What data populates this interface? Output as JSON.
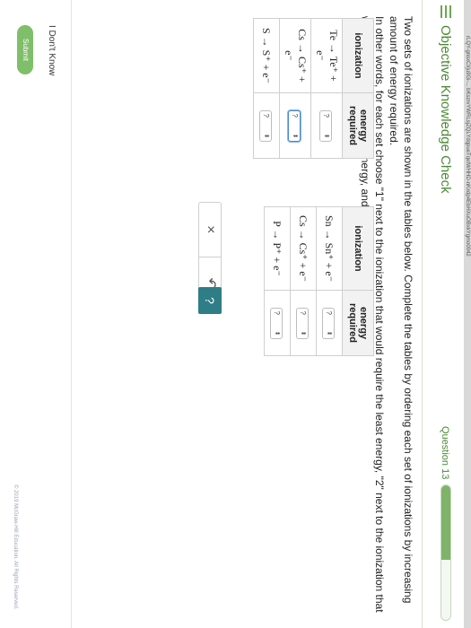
{
  "browser": {
    "url_fragment": "rLQY-gnsxCl/ju9Gi-... bKszrvYWRLsjZQLYdqpueTqetWHHD-nKxdp4EbHXuOBxkYgmo0042"
  },
  "header": {
    "title": "Objective Knowledge Check",
    "question_label": "Question 13",
    "progress": 0.55
  },
  "question": {
    "line1": "Two sets of ionizations are shown in the tables below. Complete the tables by ordering each set of ionizations by increasing amount of energy required.",
    "line2": "In other words, for each set choose \"1\" next to the ionization that would require the least energy, \"2\" next to the ionization that would require the next least energy, and so on."
  },
  "table1": {
    "headers": [
      "ionization",
      "energy required"
    ],
    "rows": [
      {
        "ionization": "Te → Te⁺ + e⁻",
        "value": "?"
      },
      {
        "ionization": "Cs → Cs⁺ + e⁻",
        "value": "?"
      },
      {
        "ionization": "S → S⁺ + e⁻",
        "value": "?"
      }
    ]
  },
  "table2": {
    "headers": [
      "ionization",
      "energy required"
    ],
    "rows": [
      {
        "ionization": "Sn → Sn⁺ + e⁻",
        "value": "?"
      },
      {
        "ionization": "Cs → Cs⁺ + e⁻",
        "value": "?"
      },
      {
        "ionization": "P → P⁺ + e⁻",
        "value": "?"
      }
    ]
  },
  "actions": {
    "clear": "×",
    "undo": "↶",
    "help": "?"
  },
  "bottom": {
    "dont_know": "I Don't Know",
    "submit": "Submit",
    "footer": "© 2019 McGraw-Hill Education. All Rights Reserved."
  },
  "colors": {
    "accent_green": "#4a8a34",
    "submit_green": "#7fbf6a",
    "help_teal": "#2f7d86"
  }
}
